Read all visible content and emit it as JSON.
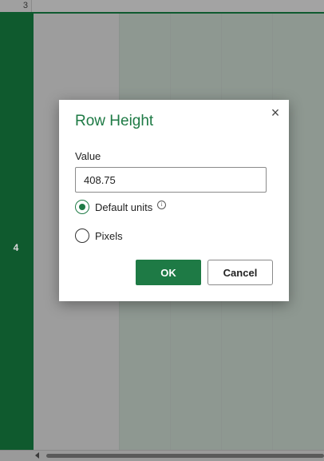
{
  "sheet": {
    "row_above": "3",
    "selected_row": "4"
  },
  "dialog": {
    "title": "Row Height",
    "value_label": "Value",
    "value": "408.75",
    "options": [
      {
        "label": "Default units",
        "selected": true,
        "has_info": true
      },
      {
        "label": "Pixels",
        "selected": false
      }
    ],
    "ok_label": "OK",
    "cancel_label": "Cancel",
    "close_glyph": "×",
    "info_glyph": "i"
  },
  "colors": {
    "accent": "#1e7a45",
    "row_header_selected": "#0f5a2e"
  }
}
